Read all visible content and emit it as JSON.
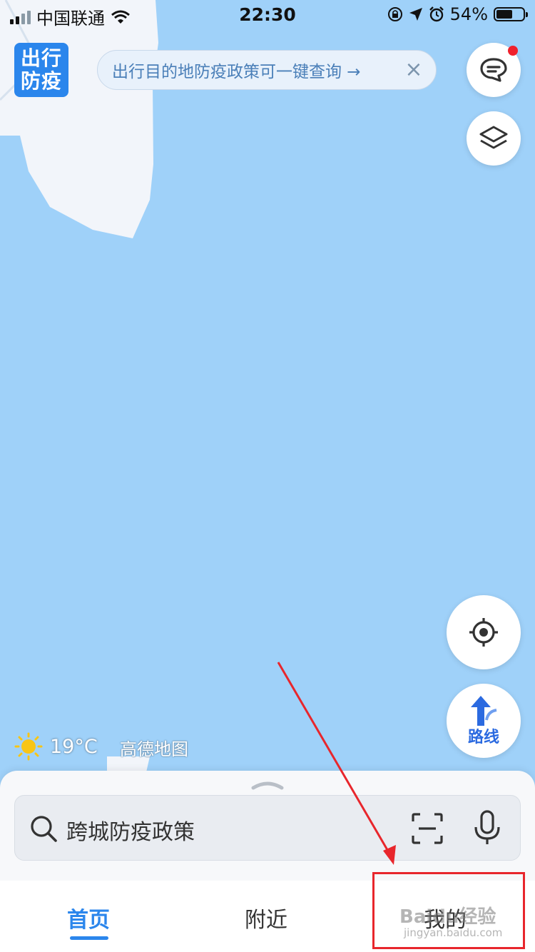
{
  "status_bar": {
    "carrier": "中国联通",
    "time": "22:30",
    "battery": "54%",
    "battery_level": 0.54
  },
  "badge": {
    "line1": "出行",
    "line2": "防疫"
  },
  "notice": {
    "text": "出行目的地防疫政策可一键查询 →",
    "close_icon": "×"
  },
  "weather": {
    "temp": "19°C",
    "icon": "sun-icon"
  },
  "map": {
    "logo": "高德地图",
    "water_color": "#9fd1f9",
    "land_color": "#f2f5fa"
  },
  "route_button": {
    "label": "路线"
  },
  "search": {
    "placeholder": "跨城防疫政策"
  },
  "tabs": [
    {
      "label": "首页",
      "active": true
    },
    {
      "label": "附近",
      "active": false
    },
    {
      "label": "我的",
      "active": false
    }
  ],
  "annotation": {
    "color": "#e8262c"
  },
  "watermark": {
    "text": "Baidu经验",
    "sub": "jingyan.baidu.com"
  }
}
